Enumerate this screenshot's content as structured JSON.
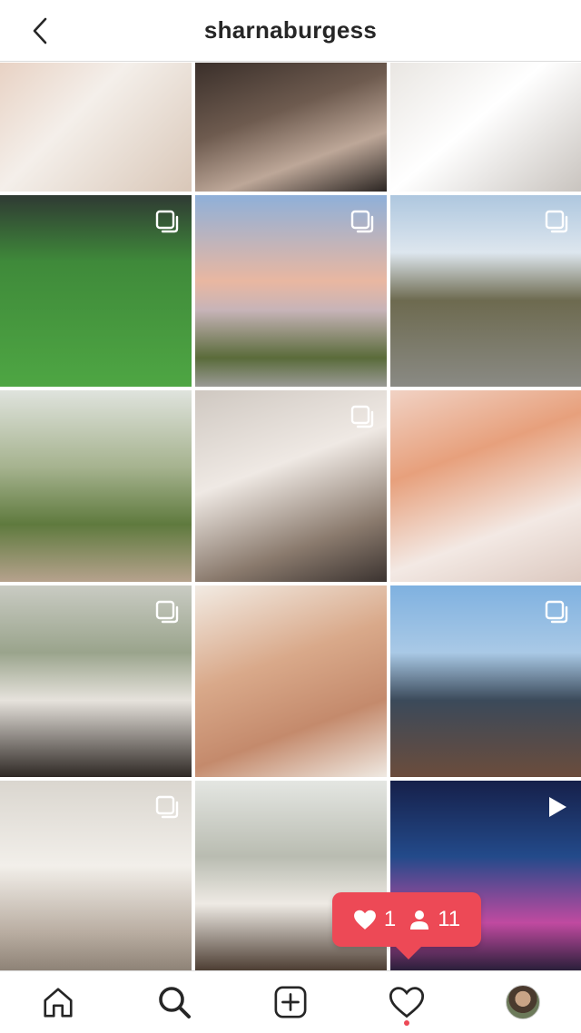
{
  "header": {
    "title": "sharnaburgess",
    "back_icon": "chevron-left-icon"
  },
  "grid": {
    "tiles": [
      {
        "name": "post-1",
        "bg": "linear-gradient(135deg,#e8d2c4 0%,#f4efea 40%,#d9c7b8 100%)",
        "badge": ""
      },
      {
        "name": "post-2",
        "bg": "linear-gradient(160deg,#3a2f2a 0%,#6e5b4f 40%,#bda798 70%,#2b2522 100%)",
        "badge": ""
      },
      {
        "name": "post-3",
        "bg": "linear-gradient(140deg,#e9e6e2 0%,#ffffff 45%,#c9c4bf 100%)",
        "badge": ""
      },
      {
        "name": "post-4",
        "bg": "linear-gradient(180deg,#2f3a33 0%,#3f8a3a 35%,#4ea643 100%)",
        "badge": "carousel-icon"
      },
      {
        "name": "post-5",
        "bg": "linear-gradient(180deg,#8fb0d9 0%,#e9b7a1 45%,#c7b4b8 60%,#5a6b3a 85%,#9a9a96 100%)",
        "badge": "carousel-icon"
      },
      {
        "name": "post-6",
        "bg": "linear-gradient(180deg,#aec7df 0%,#dde6ee 30%,#6d6a4f 55%,#8a8a84 100%)",
        "badge": "carousel-icon"
      },
      {
        "name": "post-7",
        "bg": "linear-gradient(180deg,#dfe3dd 0%,#a6b38f 40%,#5f7a3e 70%,#b6a28d 100%)",
        "badge": ""
      },
      {
        "name": "post-8",
        "bg": "linear-gradient(160deg,#cfc8c1 0%,#efe9e4 40%,#8a7a6d 75%,#3b3330 100%)",
        "badge": "carousel-icon"
      },
      {
        "name": "post-9",
        "bg": "linear-gradient(160deg,#f1d2c4 0%,#e7a07c 35%,#f3e9e4 70%,#dcc9c0 100%)",
        "badge": ""
      },
      {
        "name": "post-10",
        "bg": "linear-gradient(180deg,#c9cbc3 0%,#9aa48c 35%,#e6e2dc 60%,#2e2824 100%)",
        "badge": "carousel-icon"
      },
      {
        "name": "post-11",
        "bg": "linear-gradient(160deg,#f2ebe3 0%,#d9a98a 40%,#c48a6c 70%,#efe9e2 100%)",
        "badge": ""
      },
      {
        "name": "post-12",
        "bg": "linear-gradient(180deg,#7fb1e0 0%,#a9c9e6 35%,#3b4a5a 60%,#6b4c3c 100%)",
        "badge": "carousel-icon"
      },
      {
        "name": "post-13",
        "bg": "linear-gradient(180deg,#dad6cf 0%,#f2efea 45%,#b9ada1 80%,#8e8377 100%)",
        "badge": "carousel-icon"
      },
      {
        "name": "post-14",
        "bg": "linear-gradient(180deg,#e4e6e2 0%,#b9bcb1 40%,#eeeae4 65%,#4d3e33 100%)",
        "badge": ""
      },
      {
        "name": "post-15",
        "bg": "linear-gradient(180deg,#16204a 0%,#234a8a 40%,#c04aa0 75%,#2a1f3a 100%)",
        "badge": "video-icon"
      }
    ]
  },
  "notification": {
    "likes": "1",
    "followers": "11",
    "heart_icon": "heart-icon",
    "person_icon": "person-icon",
    "color": "#ed4956"
  },
  "tabbar": {
    "items": [
      "home-icon",
      "search-icon",
      "new-post-icon",
      "activity-heart-icon",
      "profile-avatar"
    ],
    "activity_dot_color": "#ed4956"
  }
}
